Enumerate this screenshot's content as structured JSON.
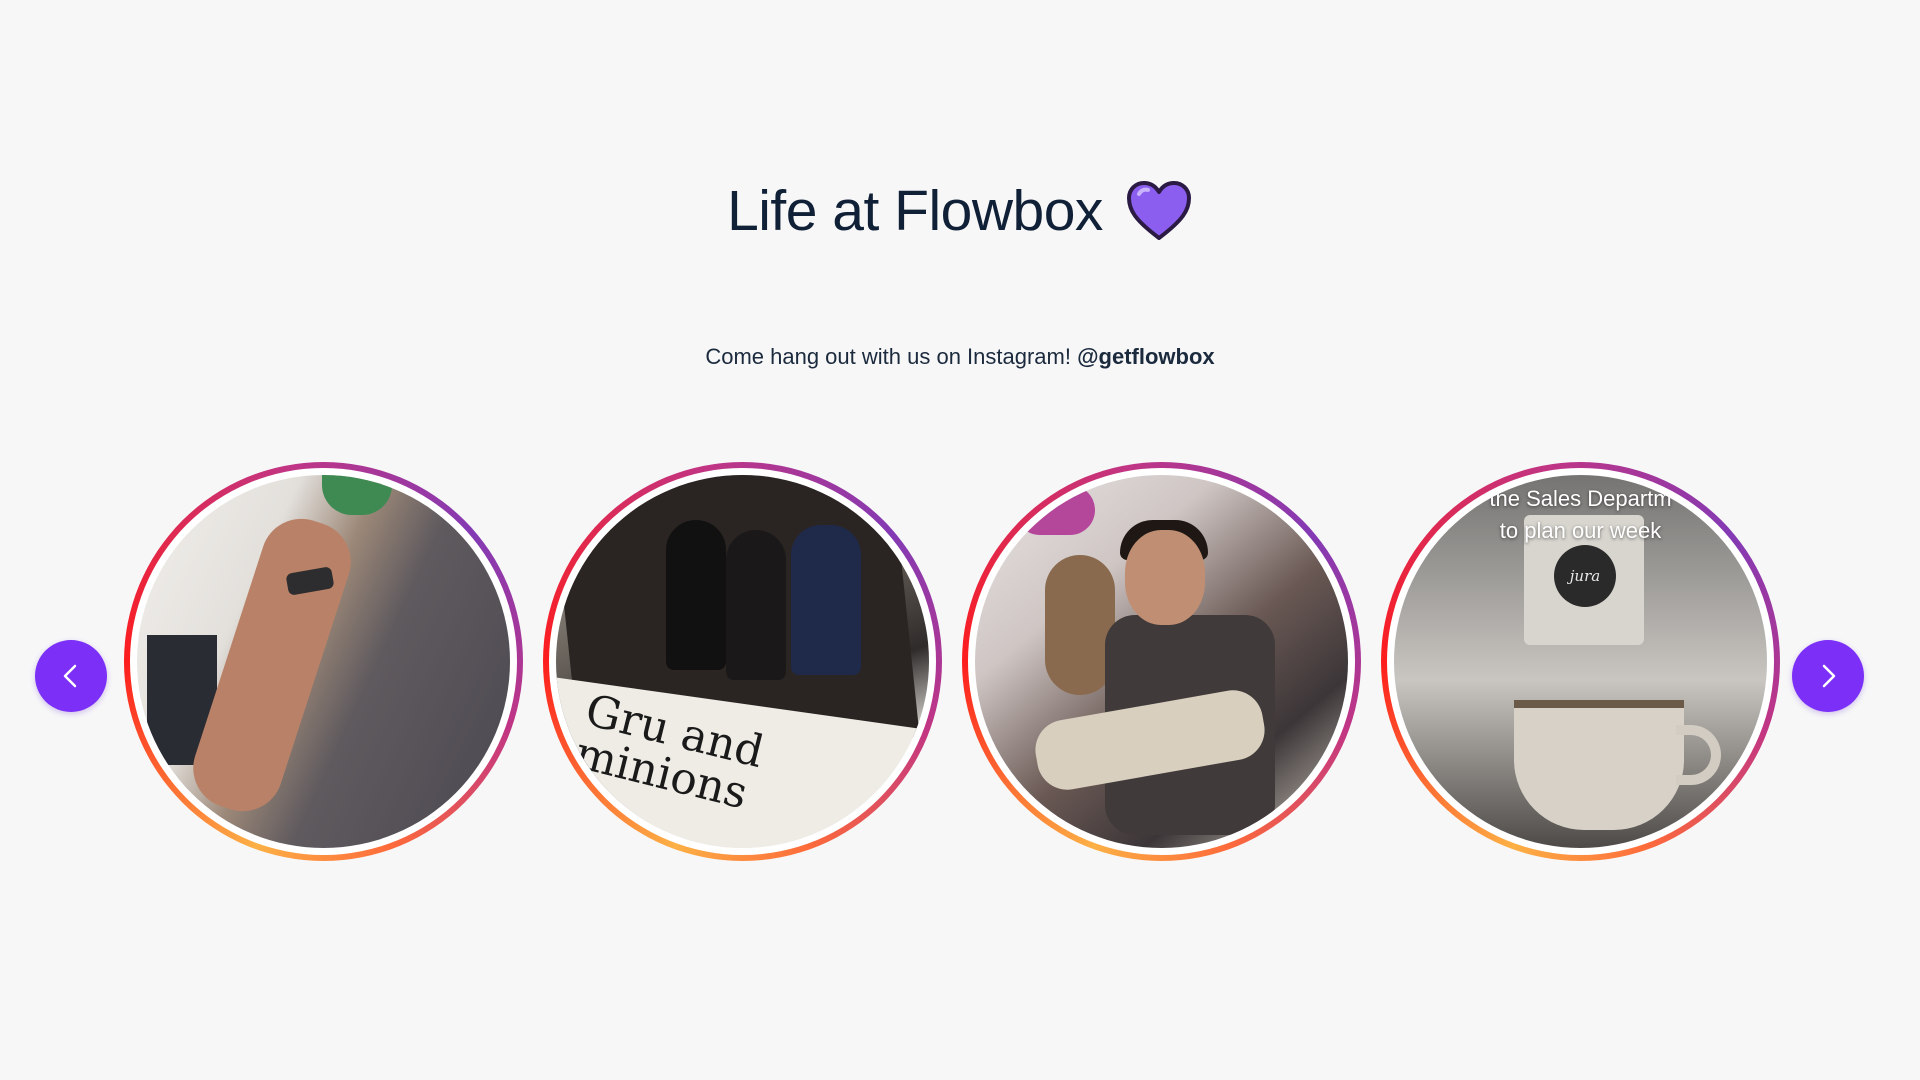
{
  "header": {
    "title": "Life at Flowbox",
    "heart_icon": "purple-heart-icon",
    "heart_color": "#7e4fe0"
  },
  "intro": {
    "text": "Come hang out with us on Instagram! ",
    "handle": "@getflowbox"
  },
  "carousel": {
    "accent_color": "#7b2ff7",
    "prev_icon": "chevron-left-icon",
    "next_icon": "chevron-right-icon",
    "stories": [
      {
        "name": "story-1"
      },
      {
        "name": "story-2",
        "handwriting": "Gru and minions"
      },
      {
        "name": "story-3"
      },
      {
        "name": "story-4",
        "caption_line1": "the Sales Departm",
        "caption_line2": "to plan our week",
        "logo_text": "jura"
      }
    ]
  }
}
